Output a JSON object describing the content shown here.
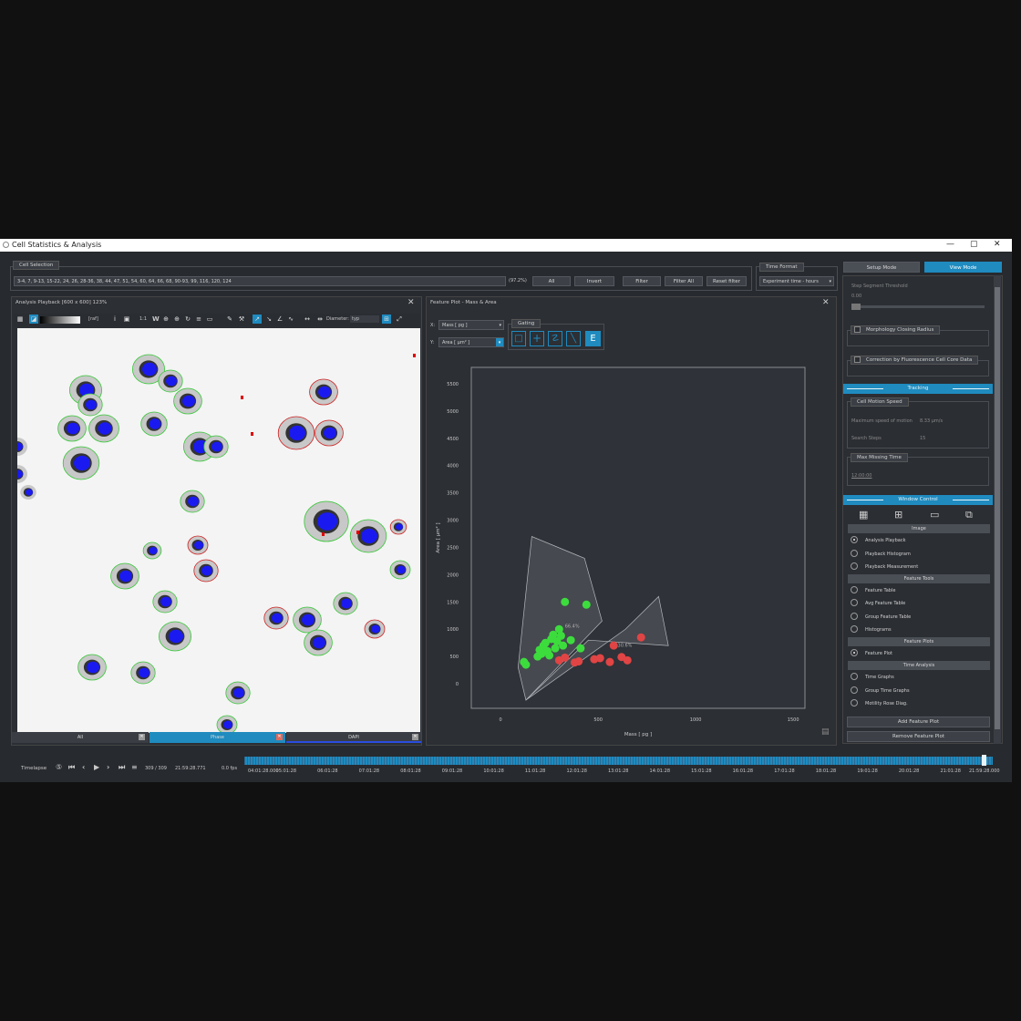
{
  "window": {
    "title": "Cell Statistics & Analysis",
    "min": "—",
    "max": "▢",
    "close": "✕"
  },
  "cell_selection": {
    "title": "Cell Selection",
    "value": "3-4, 7, 9-13, 15-22, 24, 26, 28-36, 38, 44, 47, 51, 54, 60, 64, 66, 68, 90-93, 99, 116, 120, 124",
    "percent": "(97.2%)",
    "buttons": [
      "All",
      "Invert",
      "Filter",
      "Filter All",
      "Reset filter"
    ]
  },
  "time_format": {
    "title": "Time Format",
    "value": "Experiment time - hours"
  },
  "mode_tabs": {
    "setup": "Setup Mode",
    "view": "View Mode"
  },
  "analysis_playback": {
    "title": "Analysis Playback [600 x 600] 123%",
    "toolbar": {
      "lut": "[raf]",
      "one_to_one": "1:1",
      "w": "W",
      "diameter_label": "Diameter:",
      "diameter_value": "typ",
      "icons": [
        "grid-icon",
        "brightness-icon",
        "info-icon",
        "save-icon",
        "zoom-in-icon",
        "zoom-out-icon",
        "refresh-icon",
        "lock-icon"
      ]
    },
    "channels": [
      {
        "label": "All",
        "color": "#3a3e44"
      },
      {
        "label": "Phase",
        "color": "#1f8bbf"
      },
      {
        "label": "DAPI",
        "color": "#3a3e44"
      }
    ]
  },
  "feature_plot": {
    "title": "Feature Plot - Mass & Area",
    "x_label": "X:",
    "x_value": "Mass [ pg ]",
    "y_label": "Y:",
    "y_value": "Area [ µm² ]",
    "gating_title": "Gating",
    "gate_labels": [
      "66.4%",
      "30.6%"
    ]
  },
  "chart_data": {
    "type": "scatter",
    "xlabel": "Mass [ pg ]",
    "ylabel": "Area [ µm² ]",
    "xlim": [
      -150,
      1560
    ],
    "ylim": [
      -450,
      5800
    ],
    "xticks": [
      0,
      500,
      1000,
      1500
    ],
    "yticks": [
      0,
      500,
      1000,
      1500,
      2000,
      2500,
      3000,
      3500,
      4000,
      4500,
      5000,
      5500
    ],
    "series": [
      {
        "color": "#3ddc3d",
        "points": [
          [
            120,
            400
          ],
          [
            130,
            350
          ],
          [
            190,
            500
          ],
          [
            200,
            620
          ],
          [
            210,
            550
          ],
          [
            220,
            700
          ],
          [
            230,
            750
          ],
          [
            240,
            600
          ],
          [
            250,
            520
          ],
          [
            260,
            820
          ],
          [
            270,
            900
          ],
          [
            280,
            650
          ],
          [
            290,
            780
          ],
          [
            300,
            1000
          ],
          [
            310,
            880
          ],
          [
            320,
            700
          ],
          [
            330,
            1500
          ],
          [
            360,
            800
          ],
          [
            410,
            650
          ],
          [
            440,
            1450
          ]
        ]
      },
      {
        "color": "#e04444",
        "points": [
          [
            300,
            430
          ],
          [
            330,
            480
          ],
          [
            380,
            390
          ],
          [
            400,
            410
          ],
          [
            480,
            450
          ],
          [
            510,
            470
          ],
          [
            560,
            400
          ],
          [
            580,
            700
          ],
          [
            620,
            490
          ],
          [
            650,
            430
          ],
          [
            720,
            850
          ]
        ]
      }
    ]
  },
  "right_panel": {
    "seg_threshold_label": "Step Segment Threshold",
    "seg_threshold_value": "0.00",
    "morph_label": "Morphology Closing Radius",
    "fluor_label": "Correction by Fluorescence Cell Core Data",
    "tracking": "Tracking",
    "cell_motion_speed": "Cell Motion Speed",
    "max_speed_label": "Maximum speed of motion",
    "max_speed_value": "8.33 µm/s",
    "search_steps_label": "Search Steps",
    "search_steps_value": "15",
    "max_missing_time": "Max Missing Time",
    "max_missing_value": "12:00:00",
    "window_control": "Window Control",
    "image_header": "Image",
    "image_items": [
      "Analysis Playback",
      "Playback Histogram",
      "Playback Measurement"
    ],
    "feature_tools_header": "Feature Tools",
    "feature_tools_items": [
      "Feature Table",
      "Avg Feature Table",
      "Group Feature Table",
      "Histograms"
    ],
    "feature_plots_header": "Feature Plots",
    "feature_plots_items": [
      "Feature Plot"
    ],
    "time_analysis_header": "Time Analysis",
    "time_analysis_items": [
      "Time Graphs",
      "Group Time Graphs",
      "Motility Rose Diag."
    ],
    "add_plot": "Add Feature Plot",
    "remove_plot": "Remove Feature Plot"
  },
  "timeline": {
    "label": "Timelapse",
    "frame": "309 / 309",
    "time": "21:59:28.771",
    "fps": "0.0 fps",
    "ticks": [
      "04:01:28.000",
      "05:01:28",
      "06:01:28",
      "07:01:28",
      "08:01:28",
      "09:01:28",
      "10:01:28",
      "11:01:28",
      "12:01:28",
      "13:01:28",
      "14:01:28",
      "15:01:28",
      "16:01:28",
      "17:01:28",
      "18:01:28",
      "19:01:28",
      "20:01:28",
      "21:01:28",
      "21:59:28.000"
    ]
  }
}
